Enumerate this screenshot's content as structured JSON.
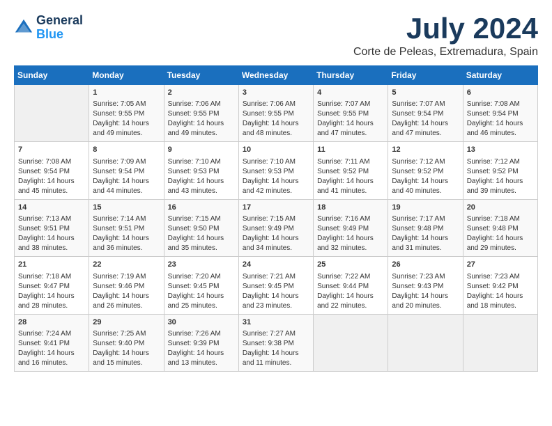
{
  "app": {
    "logo_line1": "General",
    "logo_line2": "Blue"
  },
  "header": {
    "month": "July 2024",
    "location": "Corte de Peleas, Extremadura, Spain"
  },
  "weekdays": [
    "Sunday",
    "Monday",
    "Tuesday",
    "Wednesday",
    "Thursday",
    "Friday",
    "Saturday"
  ],
  "weeks": [
    [
      {
        "day": "",
        "sunrise": "",
        "sunset": "",
        "daylight": ""
      },
      {
        "day": "1",
        "sunrise": "Sunrise: 7:05 AM",
        "sunset": "Sunset: 9:55 PM",
        "daylight": "Daylight: 14 hours and 49 minutes."
      },
      {
        "day": "2",
        "sunrise": "Sunrise: 7:06 AM",
        "sunset": "Sunset: 9:55 PM",
        "daylight": "Daylight: 14 hours and 49 minutes."
      },
      {
        "day": "3",
        "sunrise": "Sunrise: 7:06 AM",
        "sunset": "Sunset: 9:55 PM",
        "daylight": "Daylight: 14 hours and 48 minutes."
      },
      {
        "day": "4",
        "sunrise": "Sunrise: 7:07 AM",
        "sunset": "Sunset: 9:55 PM",
        "daylight": "Daylight: 14 hours and 47 minutes."
      },
      {
        "day": "5",
        "sunrise": "Sunrise: 7:07 AM",
        "sunset": "Sunset: 9:54 PM",
        "daylight": "Daylight: 14 hours and 47 minutes."
      },
      {
        "day": "6",
        "sunrise": "Sunrise: 7:08 AM",
        "sunset": "Sunset: 9:54 PM",
        "daylight": "Daylight: 14 hours and 46 minutes."
      }
    ],
    [
      {
        "day": "7",
        "sunrise": "Sunrise: 7:08 AM",
        "sunset": "Sunset: 9:54 PM",
        "daylight": "Daylight: 14 hours and 45 minutes."
      },
      {
        "day": "8",
        "sunrise": "Sunrise: 7:09 AM",
        "sunset": "Sunset: 9:54 PM",
        "daylight": "Daylight: 14 hours and 44 minutes."
      },
      {
        "day": "9",
        "sunrise": "Sunrise: 7:10 AM",
        "sunset": "Sunset: 9:53 PM",
        "daylight": "Daylight: 14 hours and 43 minutes."
      },
      {
        "day": "10",
        "sunrise": "Sunrise: 7:10 AM",
        "sunset": "Sunset: 9:53 PM",
        "daylight": "Daylight: 14 hours and 42 minutes."
      },
      {
        "day": "11",
        "sunrise": "Sunrise: 7:11 AM",
        "sunset": "Sunset: 9:52 PM",
        "daylight": "Daylight: 14 hours and 41 minutes."
      },
      {
        "day": "12",
        "sunrise": "Sunrise: 7:12 AM",
        "sunset": "Sunset: 9:52 PM",
        "daylight": "Daylight: 14 hours and 40 minutes."
      },
      {
        "day": "13",
        "sunrise": "Sunrise: 7:12 AM",
        "sunset": "Sunset: 9:52 PM",
        "daylight": "Daylight: 14 hours and 39 minutes."
      }
    ],
    [
      {
        "day": "14",
        "sunrise": "Sunrise: 7:13 AM",
        "sunset": "Sunset: 9:51 PM",
        "daylight": "Daylight: 14 hours and 38 minutes."
      },
      {
        "day": "15",
        "sunrise": "Sunrise: 7:14 AM",
        "sunset": "Sunset: 9:51 PM",
        "daylight": "Daylight: 14 hours and 36 minutes."
      },
      {
        "day": "16",
        "sunrise": "Sunrise: 7:15 AM",
        "sunset": "Sunset: 9:50 PM",
        "daylight": "Daylight: 14 hours and 35 minutes."
      },
      {
        "day": "17",
        "sunrise": "Sunrise: 7:15 AM",
        "sunset": "Sunset: 9:49 PM",
        "daylight": "Daylight: 14 hours and 34 minutes."
      },
      {
        "day": "18",
        "sunrise": "Sunrise: 7:16 AM",
        "sunset": "Sunset: 9:49 PM",
        "daylight": "Daylight: 14 hours and 32 minutes."
      },
      {
        "day": "19",
        "sunrise": "Sunrise: 7:17 AM",
        "sunset": "Sunset: 9:48 PM",
        "daylight": "Daylight: 14 hours and 31 minutes."
      },
      {
        "day": "20",
        "sunrise": "Sunrise: 7:18 AM",
        "sunset": "Sunset: 9:48 PM",
        "daylight": "Daylight: 14 hours and 29 minutes."
      }
    ],
    [
      {
        "day": "21",
        "sunrise": "Sunrise: 7:18 AM",
        "sunset": "Sunset: 9:47 PM",
        "daylight": "Daylight: 14 hours and 28 minutes."
      },
      {
        "day": "22",
        "sunrise": "Sunrise: 7:19 AM",
        "sunset": "Sunset: 9:46 PM",
        "daylight": "Daylight: 14 hours and 26 minutes."
      },
      {
        "day": "23",
        "sunrise": "Sunrise: 7:20 AM",
        "sunset": "Sunset: 9:45 PM",
        "daylight": "Daylight: 14 hours and 25 minutes."
      },
      {
        "day": "24",
        "sunrise": "Sunrise: 7:21 AM",
        "sunset": "Sunset: 9:45 PM",
        "daylight": "Daylight: 14 hours and 23 minutes."
      },
      {
        "day": "25",
        "sunrise": "Sunrise: 7:22 AM",
        "sunset": "Sunset: 9:44 PM",
        "daylight": "Daylight: 14 hours and 22 minutes."
      },
      {
        "day": "26",
        "sunrise": "Sunrise: 7:23 AM",
        "sunset": "Sunset: 9:43 PM",
        "daylight": "Daylight: 14 hours and 20 minutes."
      },
      {
        "day": "27",
        "sunrise": "Sunrise: 7:23 AM",
        "sunset": "Sunset: 9:42 PM",
        "daylight": "Daylight: 14 hours and 18 minutes."
      }
    ],
    [
      {
        "day": "28",
        "sunrise": "Sunrise: 7:24 AM",
        "sunset": "Sunset: 9:41 PM",
        "daylight": "Daylight: 14 hours and 16 minutes."
      },
      {
        "day": "29",
        "sunrise": "Sunrise: 7:25 AM",
        "sunset": "Sunset: 9:40 PM",
        "daylight": "Daylight: 14 hours and 15 minutes."
      },
      {
        "day": "30",
        "sunrise": "Sunrise: 7:26 AM",
        "sunset": "Sunset: 9:39 PM",
        "daylight": "Daylight: 14 hours and 13 minutes."
      },
      {
        "day": "31",
        "sunrise": "Sunrise: 7:27 AM",
        "sunset": "Sunset: 9:38 PM",
        "daylight": "Daylight: 14 hours and 11 minutes."
      },
      {
        "day": "",
        "sunrise": "",
        "sunset": "",
        "daylight": ""
      },
      {
        "day": "",
        "sunrise": "",
        "sunset": "",
        "daylight": ""
      },
      {
        "day": "",
        "sunrise": "",
        "sunset": "",
        "daylight": ""
      }
    ]
  ]
}
